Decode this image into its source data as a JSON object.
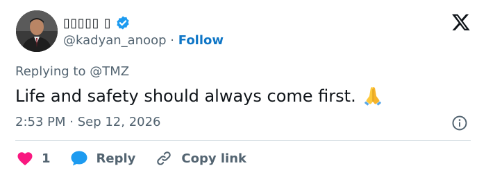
{
  "author": {
    "display_name": "▯▯▯▯▯ ▯",
    "handle": "@kadyan_anoop",
    "separator": "·",
    "follow_label": "Follow",
    "avatar": "avatar-photo",
    "verified_icon": "verified-badge-icon"
  },
  "replying": {
    "prefix": "Replying to",
    "handle": "@TMZ"
  },
  "tweet": {
    "text": "Life and safety should always come first.",
    "emoji": "folded-hands-icon",
    "timestamp": "2:53 PM · Sep 12, 2026"
  },
  "actions": {
    "like_count": "1",
    "reply_label": "Reply",
    "copy_link_label": "Copy link"
  },
  "icons": {
    "logo": "x-logo-icon",
    "info": "info-icon",
    "like": "heart-icon",
    "reply": "speech-bubble-icon",
    "copy": "link-icon"
  },
  "colors": {
    "text": "#0f1419",
    "secondary": "#536471",
    "accent": "#1d9bf0",
    "link": "#0f76c6",
    "like": "#f91880",
    "divider": "#cfd9de"
  }
}
